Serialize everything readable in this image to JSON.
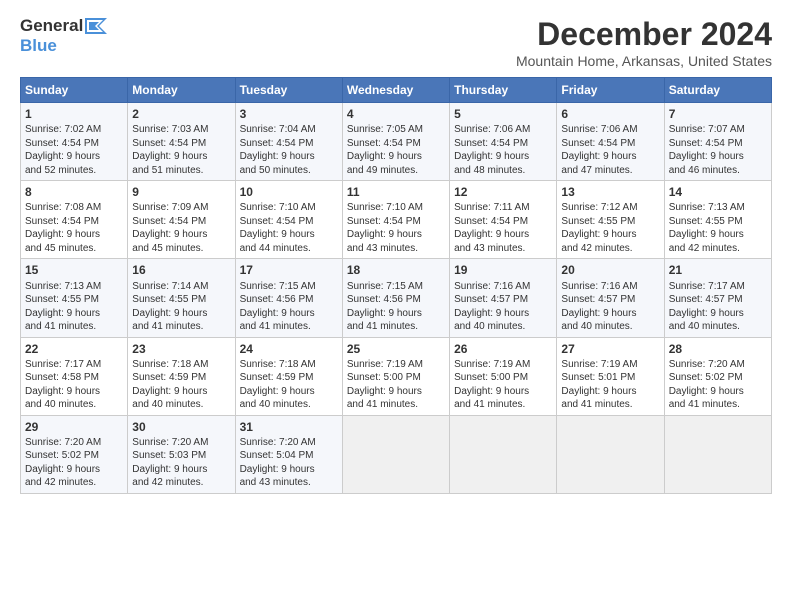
{
  "header": {
    "logo_general": "General",
    "logo_blue": "Blue",
    "title": "December 2024",
    "subtitle": "Mountain Home, Arkansas, United States"
  },
  "columns": [
    "Sunday",
    "Monday",
    "Tuesday",
    "Wednesday",
    "Thursday",
    "Friday",
    "Saturday"
  ],
  "weeks": [
    [
      {
        "day": "1",
        "lines": [
          "Sunrise: 7:02 AM",
          "Sunset: 4:54 PM",
          "Daylight: 9 hours",
          "and 52 minutes."
        ]
      },
      {
        "day": "2",
        "lines": [
          "Sunrise: 7:03 AM",
          "Sunset: 4:54 PM",
          "Daylight: 9 hours",
          "and 51 minutes."
        ]
      },
      {
        "day": "3",
        "lines": [
          "Sunrise: 7:04 AM",
          "Sunset: 4:54 PM",
          "Daylight: 9 hours",
          "and 50 minutes."
        ]
      },
      {
        "day": "4",
        "lines": [
          "Sunrise: 7:05 AM",
          "Sunset: 4:54 PM",
          "Daylight: 9 hours",
          "and 49 minutes."
        ]
      },
      {
        "day": "5",
        "lines": [
          "Sunrise: 7:06 AM",
          "Sunset: 4:54 PM",
          "Daylight: 9 hours",
          "and 48 minutes."
        ]
      },
      {
        "day": "6",
        "lines": [
          "Sunrise: 7:06 AM",
          "Sunset: 4:54 PM",
          "Daylight: 9 hours",
          "and 47 minutes."
        ]
      },
      {
        "day": "7",
        "lines": [
          "Sunrise: 7:07 AM",
          "Sunset: 4:54 PM",
          "Daylight: 9 hours",
          "and 46 minutes."
        ]
      }
    ],
    [
      {
        "day": "8",
        "lines": [
          "Sunrise: 7:08 AM",
          "Sunset: 4:54 PM",
          "Daylight: 9 hours",
          "and 45 minutes."
        ]
      },
      {
        "day": "9",
        "lines": [
          "Sunrise: 7:09 AM",
          "Sunset: 4:54 PM",
          "Daylight: 9 hours",
          "and 45 minutes."
        ]
      },
      {
        "day": "10",
        "lines": [
          "Sunrise: 7:10 AM",
          "Sunset: 4:54 PM",
          "Daylight: 9 hours",
          "and 44 minutes."
        ]
      },
      {
        "day": "11",
        "lines": [
          "Sunrise: 7:10 AM",
          "Sunset: 4:54 PM",
          "Daylight: 9 hours",
          "and 43 minutes."
        ]
      },
      {
        "day": "12",
        "lines": [
          "Sunrise: 7:11 AM",
          "Sunset: 4:54 PM",
          "Daylight: 9 hours",
          "and 43 minutes."
        ]
      },
      {
        "day": "13",
        "lines": [
          "Sunrise: 7:12 AM",
          "Sunset: 4:55 PM",
          "Daylight: 9 hours",
          "and 42 minutes."
        ]
      },
      {
        "day": "14",
        "lines": [
          "Sunrise: 7:13 AM",
          "Sunset: 4:55 PM",
          "Daylight: 9 hours",
          "and 42 minutes."
        ]
      }
    ],
    [
      {
        "day": "15",
        "lines": [
          "Sunrise: 7:13 AM",
          "Sunset: 4:55 PM",
          "Daylight: 9 hours",
          "and 41 minutes."
        ]
      },
      {
        "day": "16",
        "lines": [
          "Sunrise: 7:14 AM",
          "Sunset: 4:55 PM",
          "Daylight: 9 hours",
          "and 41 minutes."
        ]
      },
      {
        "day": "17",
        "lines": [
          "Sunrise: 7:15 AM",
          "Sunset: 4:56 PM",
          "Daylight: 9 hours",
          "and 41 minutes."
        ]
      },
      {
        "day": "18",
        "lines": [
          "Sunrise: 7:15 AM",
          "Sunset: 4:56 PM",
          "Daylight: 9 hours",
          "and 41 minutes."
        ]
      },
      {
        "day": "19",
        "lines": [
          "Sunrise: 7:16 AM",
          "Sunset: 4:57 PM",
          "Daylight: 9 hours",
          "and 40 minutes."
        ]
      },
      {
        "day": "20",
        "lines": [
          "Sunrise: 7:16 AM",
          "Sunset: 4:57 PM",
          "Daylight: 9 hours",
          "and 40 minutes."
        ]
      },
      {
        "day": "21",
        "lines": [
          "Sunrise: 7:17 AM",
          "Sunset: 4:57 PM",
          "Daylight: 9 hours",
          "and 40 minutes."
        ]
      }
    ],
    [
      {
        "day": "22",
        "lines": [
          "Sunrise: 7:17 AM",
          "Sunset: 4:58 PM",
          "Daylight: 9 hours",
          "and 40 minutes."
        ]
      },
      {
        "day": "23",
        "lines": [
          "Sunrise: 7:18 AM",
          "Sunset: 4:59 PM",
          "Daylight: 9 hours",
          "and 40 minutes."
        ]
      },
      {
        "day": "24",
        "lines": [
          "Sunrise: 7:18 AM",
          "Sunset: 4:59 PM",
          "Daylight: 9 hours",
          "and 40 minutes."
        ]
      },
      {
        "day": "25",
        "lines": [
          "Sunrise: 7:19 AM",
          "Sunset: 5:00 PM",
          "Daylight: 9 hours",
          "and 41 minutes."
        ]
      },
      {
        "day": "26",
        "lines": [
          "Sunrise: 7:19 AM",
          "Sunset: 5:00 PM",
          "Daylight: 9 hours",
          "and 41 minutes."
        ]
      },
      {
        "day": "27",
        "lines": [
          "Sunrise: 7:19 AM",
          "Sunset: 5:01 PM",
          "Daylight: 9 hours",
          "and 41 minutes."
        ]
      },
      {
        "day": "28",
        "lines": [
          "Sunrise: 7:20 AM",
          "Sunset: 5:02 PM",
          "Daylight: 9 hours",
          "and 41 minutes."
        ]
      }
    ],
    [
      {
        "day": "29",
        "lines": [
          "Sunrise: 7:20 AM",
          "Sunset: 5:02 PM",
          "Daylight: 9 hours",
          "and 42 minutes."
        ]
      },
      {
        "day": "30",
        "lines": [
          "Sunrise: 7:20 AM",
          "Sunset: 5:03 PM",
          "Daylight: 9 hours",
          "and 42 minutes."
        ]
      },
      {
        "day": "31",
        "lines": [
          "Sunrise: 7:20 AM",
          "Sunset: 5:04 PM",
          "Daylight: 9 hours",
          "and 43 minutes."
        ]
      },
      {
        "day": "",
        "lines": []
      },
      {
        "day": "",
        "lines": []
      },
      {
        "day": "",
        "lines": []
      },
      {
        "day": "",
        "lines": []
      }
    ]
  ]
}
